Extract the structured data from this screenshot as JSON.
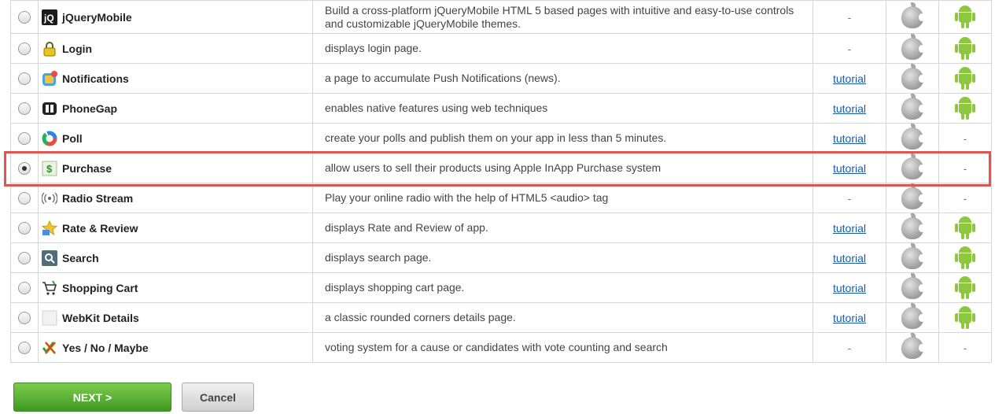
{
  "rows": [
    {
      "name": "jQueryMobile",
      "icon": "jquerymobile-icon",
      "desc": "Build a cross-platform jQueryMobile HTML 5 based pages with intuitive and easy-to-use controls and customizable jQueryMobile themes.",
      "tutorial": "-",
      "ios": true,
      "android": true,
      "selected": false
    },
    {
      "name": "Login",
      "icon": "lock-icon",
      "desc": "displays login page.",
      "tutorial": "-",
      "ios": true,
      "android": true,
      "selected": false
    },
    {
      "name": "Notifications",
      "icon": "notifications-icon",
      "desc": "a page to accumulate Push Notifications (news).",
      "tutorial": "tutorial",
      "ios": true,
      "android": true,
      "selected": false
    },
    {
      "name": "PhoneGap",
      "icon": "phonegap-icon",
      "desc": "enables native features using web techniques",
      "tutorial": "tutorial",
      "ios": true,
      "android": true,
      "selected": false
    },
    {
      "name": "Poll",
      "icon": "poll-icon",
      "desc": "create your polls and publish them on your app in less than 5 minutes.",
      "tutorial": "tutorial",
      "ios": true,
      "android": false,
      "selected": false
    },
    {
      "name": "Purchase",
      "icon": "purchase-icon",
      "desc": "allow users to sell their products using Apple InApp Purchase system",
      "tutorial": "tutorial",
      "ios": true,
      "android": false,
      "selected": true
    },
    {
      "name": "Radio Stream",
      "icon": "radio-stream-icon",
      "desc": "Play your online radio with the help of HTML5 <audio> tag",
      "tutorial": "-",
      "ios": true,
      "android": false,
      "selected": false
    },
    {
      "name": "Rate & Review",
      "icon": "star-icon",
      "desc": "displays Rate and Review of app.",
      "tutorial": "tutorial",
      "ios": true,
      "android": true,
      "selected": false
    },
    {
      "name": "Search",
      "icon": "search-icon",
      "desc": "displays search page.",
      "tutorial": "tutorial",
      "ios": true,
      "android": true,
      "selected": false
    },
    {
      "name": "Shopping Cart",
      "icon": "shopping-cart-icon",
      "desc": "displays shopping cart page.",
      "tutorial": "tutorial",
      "ios": true,
      "android": true,
      "selected": false
    },
    {
      "name": "WebKit Details",
      "icon": "webkit-icon",
      "desc": "a classic rounded corners details page.",
      "tutorial": "tutorial",
      "ios": true,
      "android": true,
      "selected": false
    },
    {
      "name": "Yes / No / Maybe",
      "icon": "yes-no-maybe-icon",
      "desc": "voting system for a cause or candidates with vote counting and search",
      "tutorial": "-",
      "ios": true,
      "android": false,
      "selected": false
    }
  ],
  "buttons": {
    "next": "NEXT >",
    "cancel": "Cancel"
  },
  "colors": {
    "accent_green": "#8dc63f",
    "highlight": "#e0554f",
    "link": "#1a5aa8"
  }
}
